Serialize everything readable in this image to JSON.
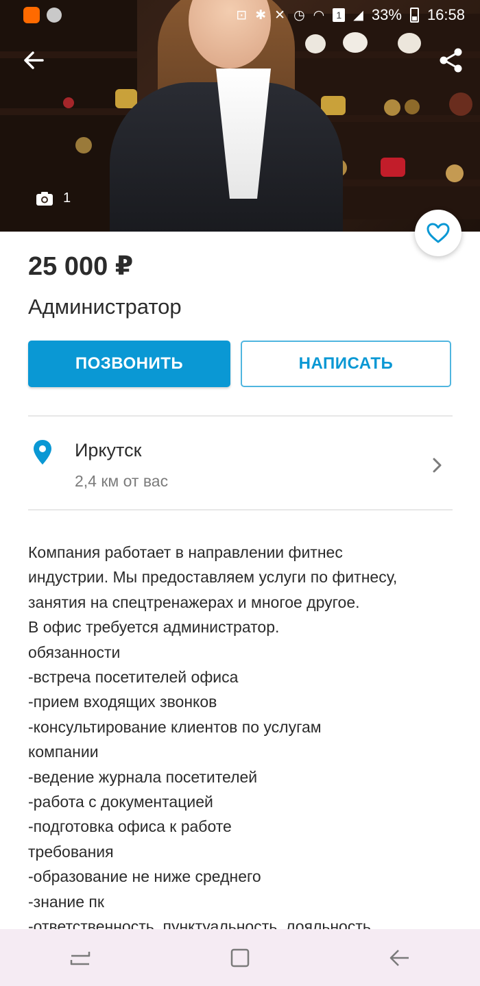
{
  "status_bar": {
    "battery_percent": "33%",
    "time": "16:58",
    "sim_label": "1"
  },
  "hero": {
    "photo_count": "1",
    "icons": {
      "back": "arrow-left-icon",
      "share": "share-icon",
      "camera": "camera-icon",
      "favorite": "heart-outline-icon"
    }
  },
  "listing": {
    "price": "25 000 ₽",
    "title": "Администратор"
  },
  "actions": {
    "call_label": "ПОЗВОНИТЬ",
    "write_label": "НАПИСАТЬ",
    "accent_color": "#0a98d4"
  },
  "location": {
    "city": "Иркутск",
    "distance": "2,4 км от вас",
    "icon": "location-pin-icon"
  },
  "description": {
    "lines": [
      "Компания работает в направлении фитнес",
      "индустрии. Мы предоставляем услуги по фитнесу,",
      "занятия на спецтренажерах и многое другое.",
      "В офис требуется администратор.",
      "обязанности",
      "-встреча посетителей офиса",
      "-прием входящих звонков",
      "-консультирование клиентов по услугам",
      "компании",
      "-ведение журнала посетителей",
      "-работа с документацией",
      "-подготовка офиса к работе",
      "требования",
      "-образование не ниже среднего",
      "-знание пк",
      "-ответственность, пунктуальность, лояльность"
    ]
  },
  "nav_bar": {
    "icons": [
      "recent-apps-icon",
      "home-icon",
      "back-icon"
    ]
  }
}
